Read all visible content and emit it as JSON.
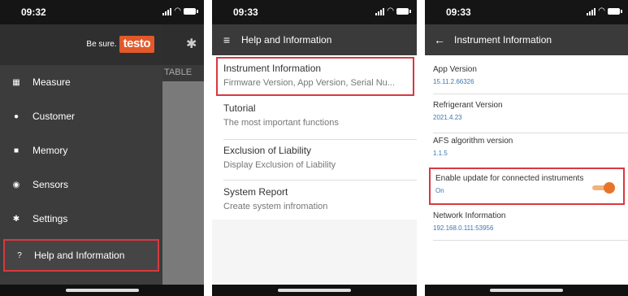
{
  "screen1": {
    "time": "09:32",
    "brand_tagline": "Be sure.",
    "brand_logo": "testo",
    "behind_tab_label": "TABLE",
    "menu": [
      {
        "icon": "grid-icon",
        "glyph": "▦",
        "label": "Measure"
      },
      {
        "icon": "person-icon",
        "glyph": "●",
        "label": "Customer"
      },
      {
        "icon": "memory-icon",
        "glyph": "■",
        "label": "Memory"
      },
      {
        "icon": "sensor-icon",
        "glyph": "◉",
        "label": "Sensors"
      },
      {
        "icon": "gear-icon",
        "glyph": "✱",
        "label": "Settings"
      },
      {
        "icon": "help-icon",
        "glyph": "?",
        "label": "Help and Information"
      }
    ],
    "highlight_color": "#d9383f"
  },
  "screen2": {
    "time": "09:33",
    "title": "Help and Information",
    "items": [
      {
        "title": "Instrument Information",
        "subtitle": "Firmware Version, App Version, Serial Nu..."
      },
      {
        "title": "Tutorial",
        "subtitle": "The most important functions"
      },
      {
        "title": "Exclusion of Liability",
        "subtitle": "Display Exclusion of Liability"
      },
      {
        "title": "System Report",
        "subtitle": "Create system infromation"
      }
    ]
  },
  "screen3": {
    "time": "09:33",
    "title": "Instrument Information",
    "items": [
      {
        "title": "App Version",
        "value": "15.11.2.66326"
      },
      {
        "title": "Refrigerant Version",
        "value": "2021.4.23"
      },
      {
        "title": "AFS algorithm version",
        "value": "1.1.5"
      },
      {
        "title": "Enable update for connected instruments",
        "value": "On",
        "toggle_on": true
      },
      {
        "title": "Network Information",
        "value": "192.168.0.111:53956"
      }
    ],
    "accent_color": "#e8742a"
  }
}
